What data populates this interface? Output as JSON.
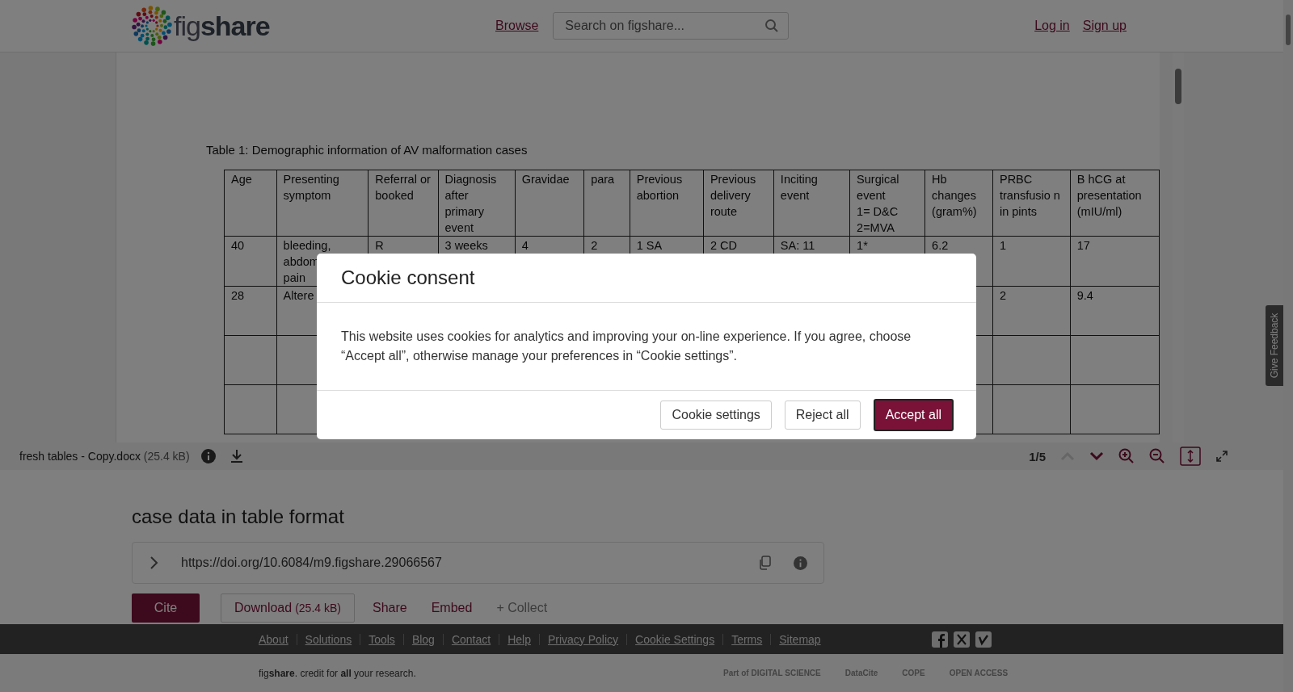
{
  "header": {
    "logo": "fig**share**",
    "nav": [
      {
        "label": "Browse"
      }
    ],
    "search": {
      "placeholder": "Search on figshare..."
    },
    "auth": [
      {
        "label": "Log in"
      },
      {
        "label": "Sign up"
      }
    ]
  },
  "viewer": {
    "caption": "Table 1: Demographic information of AV malformation cases",
    "columns": [
      "Age",
      "Presenting symptom",
      "Referral or booked",
      "Diagnosis after primary event",
      "Gravidae",
      "para",
      "Previous abortion",
      "Previous delivery route",
      "Inciting event",
      "Surgical event\n1= D&C\n2=MVA",
      "Hb changes (gram%)",
      "PRBC transfusio n in pints",
      "B hCG at presentation (mIU/ml)"
    ],
    "rows": [
      {
        "cells": [
          "40",
          "bleeding,\nabdom\npain",
          "R",
          "3 weeks",
          "4",
          "2",
          "1 SA",
          "2 CD",
          "SA: 11",
          "1*",
          "6.2",
          "1",
          "17"
        ]
      },
      {
        "cells": [
          "28",
          "Altere",
          null,
          null,
          null,
          null,
          null,
          null,
          null,
          null,
          null,
          "2",
          "9.4"
        ]
      }
    ],
    "file_name": "fresh tables - Copy.docx",
    "file_size": "(25.4 kB)",
    "page": "1/5"
  },
  "article": {
    "title": "case data in table format",
    "doi": "https://doi.org/10.6084/m9.figshare.29066567",
    "actions": [
      {
        "kind": "primary",
        "label": "Cite"
      },
      {
        "kind": "outline",
        "label": "Download",
        "detail": "(25.4 kB)"
      },
      {
        "kind": "link",
        "label": "Share"
      },
      {
        "kind": "link",
        "label": "Embed"
      },
      {
        "kind": "muted",
        "label": "+ Collect"
      }
    ]
  },
  "feedback": "Give Feedback",
  "footer": {
    "links": [
      "About",
      "Solutions",
      "Tools",
      "Blog",
      "Contact",
      "Help",
      "Privacy Policy",
      "Cookie Settings",
      "Terms",
      "Sitemap"
    ],
    "tagline": "fig**share**. credit for **all** your research.",
    "partners": [
      "Part of DIGITAL SCIENCE",
      "DataCite",
      "COPE",
      "OPEN ACCESS"
    ]
  },
  "modal": {
    "title": "Cookie consent",
    "body": "This website uses cookies for analytics and improving your on-line experience. If you agree, choose “Accept all”, otherwise manage your preferences in “Cookie settings”.",
    "buttons": [
      {
        "kind": "secondary",
        "label": "Cookie settings"
      },
      {
        "kind": "secondary",
        "label": "Reject all"
      },
      {
        "kind": "primary",
        "label": "Accept all"
      }
    ]
  }
}
